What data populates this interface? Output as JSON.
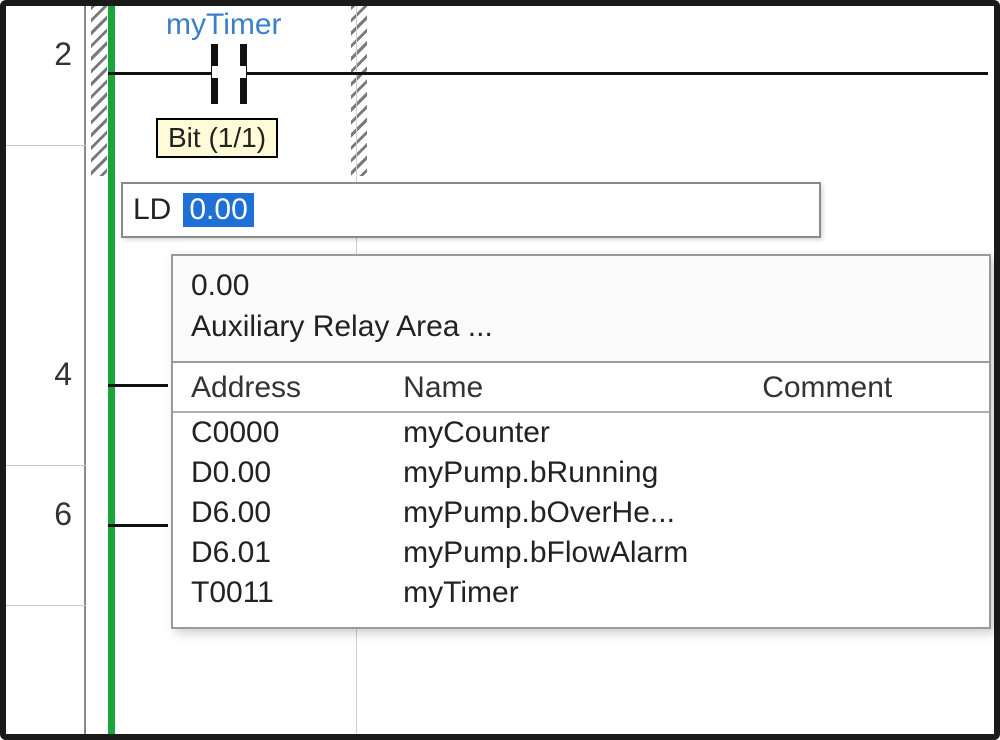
{
  "rungs": {
    "r0": "2",
    "r1": "4",
    "r2": "6"
  },
  "contact": {
    "tag": "myTimer"
  },
  "tooltip": {
    "text": "Bit (1/1)"
  },
  "input": {
    "mnemonic": "LD",
    "value": "0.00"
  },
  "popup": {
    "info_addr": "0.00",
    "info_area": "Auxiliary Relay Area ...",
    "columns": {
      "c0": "Address",
      "c1": "Name",
      "c2": "Comment"
    },
    "rows": [
      {
        "addr": "C0000",
        "name": "myCounter",
        "comment": ""
      },
      {
        "addr": "D0.00",
        "name": "myPump.bRunning",
        "comment": ""
      },
      {
        "addr": "D6.00",
        "name": "myPump.bOverHe...",
        "comment": ""
      },
      {
        "addr": "D6.01",
        "name": "myPump.bFlowAlarm",
        "comment": ""
      },
      {
        "addr": "T0011",
        "name": "myTimer",
        "comment": ""
      }
    ]
  }
}
